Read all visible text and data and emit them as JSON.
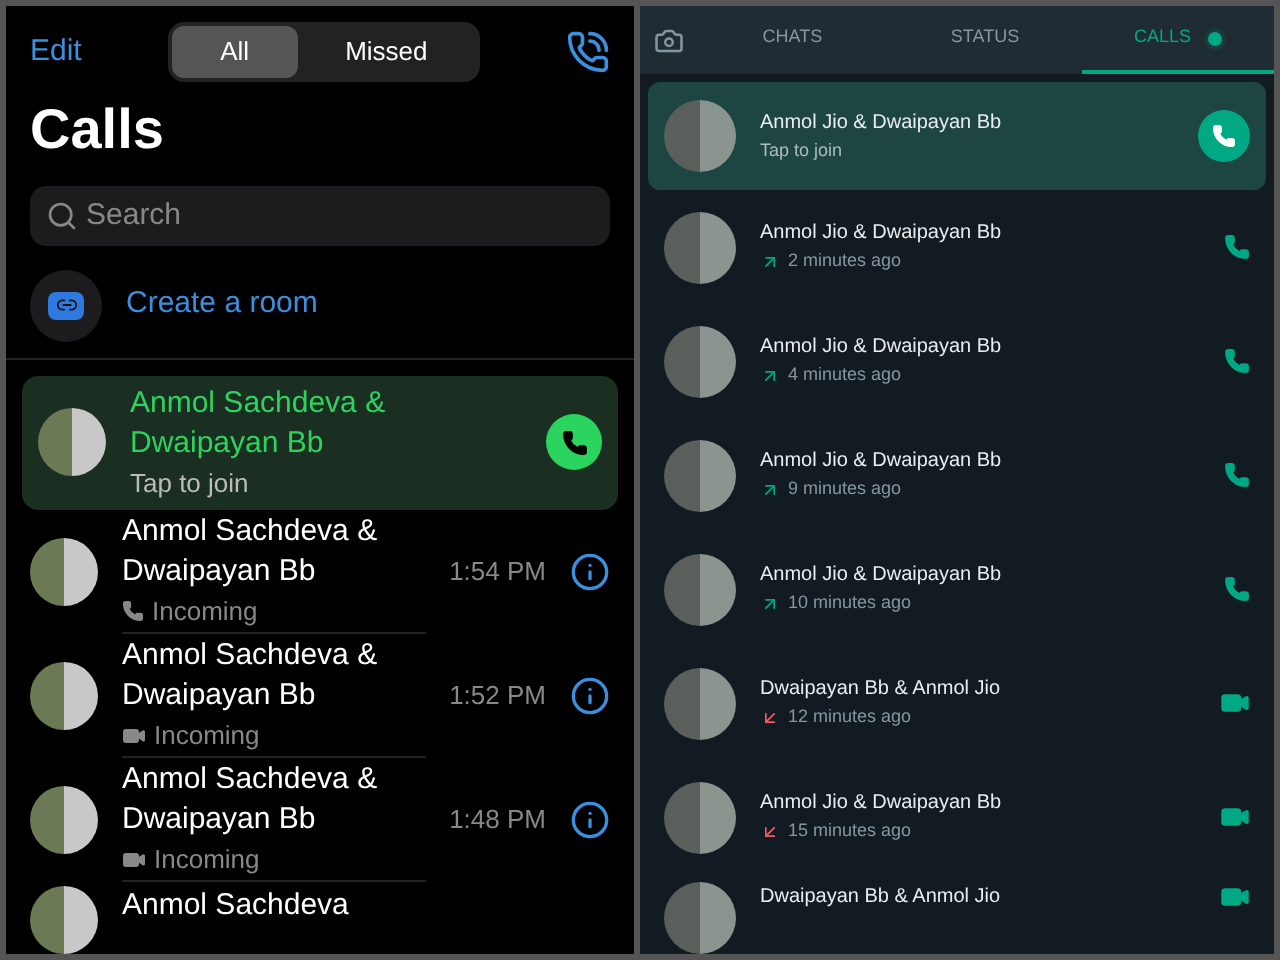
{
  "ios": {
    "edit": "Edit",
    "segments": [
      {
        "label": "All",
        "selected": true
      },
      {
        "label": "Missed",
        "selected": false
      }
    ],
    "title": "Calls",
    "search": {
      "placeholder": "Search"
    },
    "create_room": "Create a room",
    "active_call": {
      "name": "Anmol Sachdeva & Dwaipayan Bb",
      "subtitle": "Tap to join"
    },
    "calls": [
      {
        "name": "Anmol Sachdeva & Dwaipayan Bb",
        "kind": "voice",
        "status": "Incoming",
        "time": "1:54 PM"
      },
      {
        "name": "Anmol Sachdeva & Dwaipayan Bb",
        "kind": "video",
        "status": "Incoming",
        "time": "1:52 PM"
      },
      {
        "name": "Anmol Sachdeva & Dwaipayan Bb",
        "kind": "video",
        "status": "Incoming",
        "time": "1:48 PM"
      },
      {
        "name": "Anmol Sachdeva",
        "kind": "partial"
      }
    ]
  },
  "android": {
    "tabs": [
      {
        "label": "CHATS",
        "selected": false
      },
      {
        "label": "STATUS",
        "selected": false
      },
      {
        "label": "CALLS",
        "selected": true,
        "dot": true
      }
    ],
    "active_call": {
      "name": "Anmol Jio & Dwaipayan Bb",
      "subtitle": "Tap to join"
    },
    "calls": [
      {
        "name": "Anmol Jio & Dwaipayan Bb",
        "outgoing": true,
        "time": "2 minutes ago",
        "kind": "voice"
      },
      {
        "name": "Anmol Jio & Dwaipayan Bb",
        "outgoing": true,
        "time": "4 minutes ago",
        "kind": "voice"
      },
      {
        "name": "Anmol Jio & Dwaipayan Bb",
        "outgoing": true,
        "time": "9 minutes ago",
        "kind": "voice"
      },
      {
        "name": "Anmol Jio & Dwaipayan Bb",
        "outgoing": true,
        "time": "10 minutes ago",
        "kind": "voice"
      },
      {
        "name": "Dwaipayan Bb & Anmol Jio",
        "outgoing": false,
        "time": "12 minutes ago",
        "kind": "video"
      },
      {
        "name": "Anmol Jio & Dwaipayan Bb",
        "outgoing": false,
        "time": "15 minutes ago",
        "kind": "video"
      },
      {
        "name": "Dwaipayan Bb & Anmol Jio",
        "kind": "partial"
      }
    ]
  }
}
